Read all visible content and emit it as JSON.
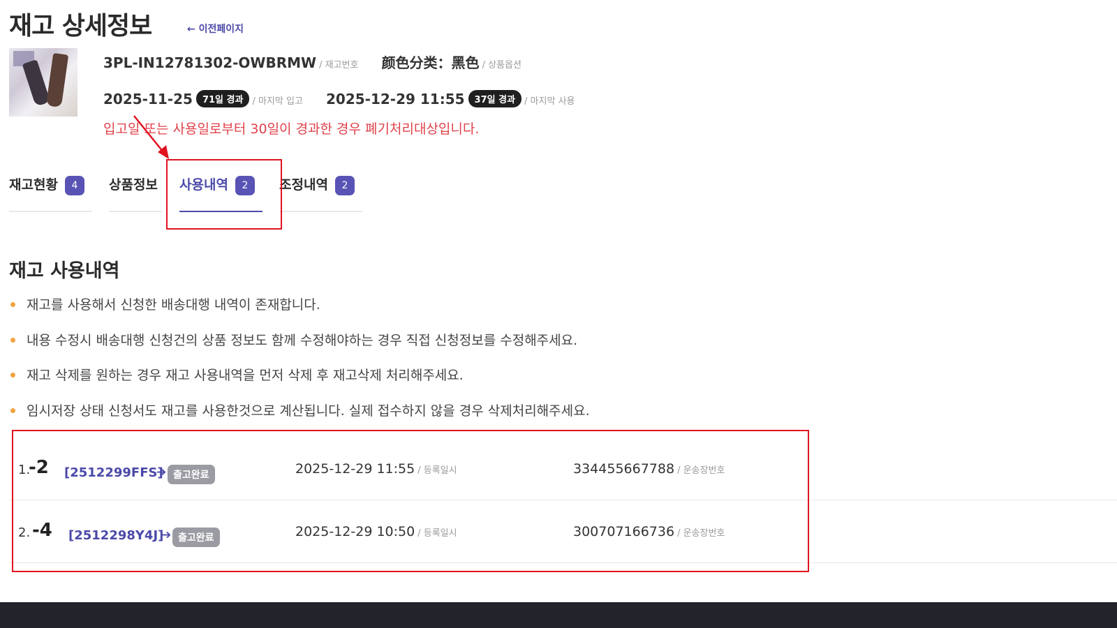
{
  "header": {
    "title": "재고 상세정보",
    "back_link": "← 이전페이지"
  },
  "product": {
    "inventory_no": "3PL-IN12781302-OWBRMW",
    "inventory_no_label": "/ 재고번호",
    "option": "颜色分类：黑色",
    "option_label": "/ 상품옵션",
    "last_in_date": "2025-11-25",
    "last_in_elapsed": "71일 경과",
    "last_in_label": "/ 마지막 입고",
    "last_use_date": "2025-12-29 11:55",
    "last_use_elapsed": "37일 경과",
    "last_use_label": "/ 마지막 사용",
    "warning": "입고일 또는 사용일로부터 30일이 경과한 경우 폐기처리대상입니다."
  },
  "tabs": [
    {
      "label": "재고현황",
      "badge": "4",
      "active": false
    },
    {
      "label": "상품정보",
      "badge": "",
      "active": false
    },
    {
      "label": "사용내역",
      "badge": "2",
      "active": true
    },
    {
      "label": "조정내역",
      "badge": "2",
      "active": false
    }
  ],
  "section": {
    "title": "재고 사용내역",
    "notes": [
      "재고를 사용해서 신청한 배송대행 내역이 존재합니다.",
      "내용 수정시 배송대행 신청건의 상품 정보도 함께 수정해야하는 경우 직접 신청정보를 수정해주세요.",
      "재고 삭제를 원하는 경우 재고 사용내역을 먼저 삭제 후 재고삭제 처리해주세요.",
      "임시저장 상태 신청서도 재고를 사용한것으로 계산됩니다. 실제 접수하지 않을 경우 삭제처리해주세요."
    ]
  },
  "usage_rows": [
    {
      "index": "1.",
      "qty": "-2",
      "order_code": "[2512299FFS]",
      "arrow": "➔",
      "status": "출고완료",
      "registered_at": "2025-12-29 11:55",
      "registered_label": "/ 등록일시",
      "tracking_no": "334455667788",
      "tracking_label": "/ 운송장번호"
    },
    {
      "index": "2.",
      "qty": "-4",
      "order_code": "[2512298Y4J]",
      "arrow": "➔",
      "status": "출고완료",
      "registered_at": "2025-12-29 10:50",
      "registered_label": "/ 등록일시",
      "tracking_no": "300707166736",
      "tracking_label": "/ 운송장번호"
    }
  ],
  "colors": {
    "accent": "#4b49a8",
    "badge": "#5853b5",
    "warning": "#e0414a",
    "highlight": "#e0131f",
    "bullet": "#f2a340"
  }
}
